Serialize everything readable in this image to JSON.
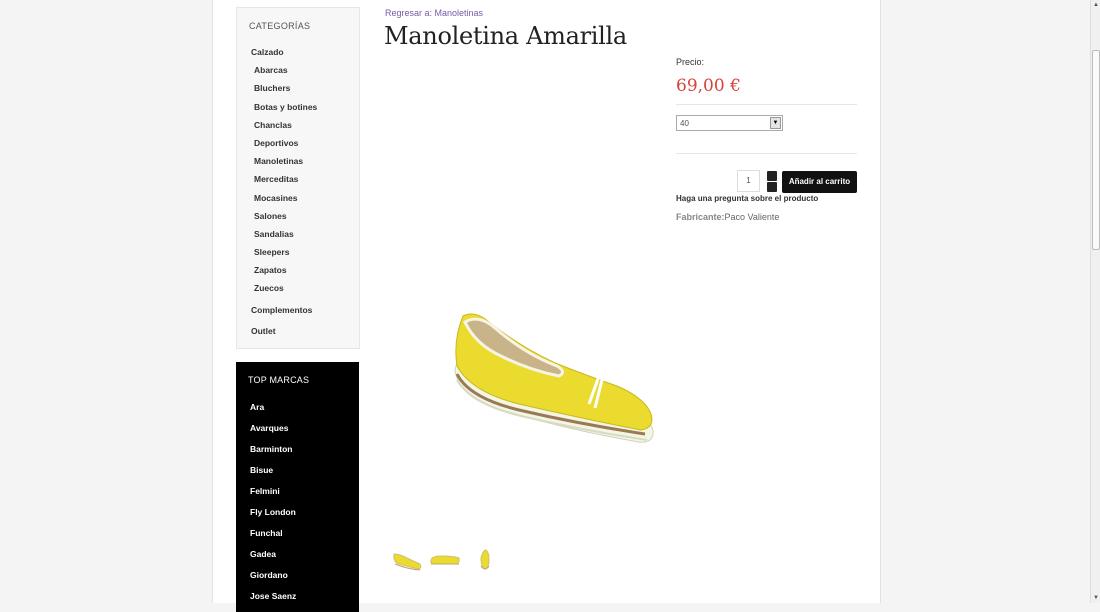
{
  "sidebar": {
    "categories_title": "CATEGORÍAS",
    "categories": [
      {
        "label": "Calzado",
        "sub": false
      },
      {
        "label": "Abarcas",
        "sub": true
      },
      {
        "label": "Bluchers",
        "sub": true
      },
      {
        "label": "Botas y botines",
        "sub": true
      },
      {
        "label": "Chanclas",
        "sub": true
      },
      {
        "label": "Deportivos",
        "sub": true
      },
      {
        "label": "Manoletinas",
        "sub": true
      },
      {
        "label": "Merceditas",
        "sub": true
      },
      {
        "label": "Mocasines",
        "sub": true
      },
      {
        "label": "Salones",
        "sub": true
      },
      {
        "label": "Sandalias",
        "sub": true
      },
      {
        "label": "Sleepers",
        "sub": true
      },
      {
        "label": "Zapatos",
        "sub": true
      },
      {
        "label": "Zuecos",
        "sub": true
      },
      {
        "label": "Complementos",
        "sub": false
      },
      {
        "label": "Outlet",
        "sub": false
      }
    ],
    "brands_title": "TOP MARCAS",
    "brands": [
      "Ara",
      "Avarques",
      "Barminton",
      "Bisue",
      "Felmini",
      "Fly London",
      "Funchal",
      "Gadea",
      "Giordano",
      "Jose Saenz"
    ]
  },
  "product": {
    "back_link": "Regresar a: Manoletinas",
    "title": "Manoletina Amarilla",
    "price_label": "Precio:",
    "price": "69,00 €",
    "size_value": "40",
    "quantity": "1",
    "add_to_cart": "Añadir al carrito",
    "ask_question": "Haga una pregunta sobre el producto",
    "maker_label": "Fabricante:",
    "maker_name": "Paco Valiente"
  },
  "colors": {
    "price": "#d9403a",
    "link": "#7a5aa6",
    "shoe": "#e8d630"
  }
}
